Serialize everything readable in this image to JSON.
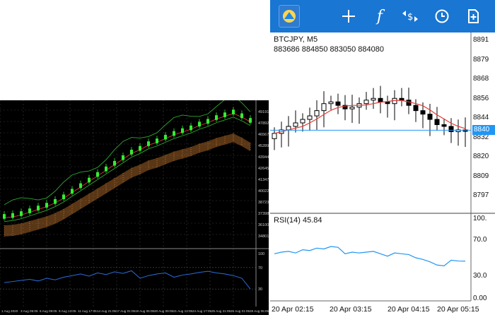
{
  "left_panel": {
    "price_ticks": [
      "491911",
      "478926",
      "465679",
      "452890",
      "439441",
      "426456",
      "413471",
      "400221",
      "387236",
      "373986",
      "361001",
      "348016"
    ],
    "rsi_ticks": [
      "100",
      "70",
      "30"
    ],
    "time_ticks": [
      "1 Aug 2020",
      "3 Aug 05:05",
      "6 Aug 09:05",
      "9 Aug 13:05",
      "11 Aug 17:05",
      "14 Aug 21:05",
      "17 Aug 01:05",
      "19 Aug 05:05",
      "20 Aug 09:05",
      "21 Aug 13:05",
      "24 Aug 17:05",
      "25 Aug 21:05",
      "26 Aug 01:05",
      "28 Aug 05:05"
    ],
    "colors": {
      "background": "#000000",
      "candles": "#33ee33",
      "cloud": "#ff9a3c",
      "rsi": "#2b6cd8"
    }
  },
  "app": {
    "toolbar": {
      "icons": [
        "mt-logo-icon",
        "crosshair-icon",
        "indicators-icon",
        "trade-icon",
        "timeframe-icon",
        "add-object-icon"
      ],
      "color": "#1976d2"
    },
    "chart": {
      "symbol": "BTCJPY, M5",
      "ohlc": "883686 884850 883050 884080",
      "current_price": "8840",
      "price_ticks": [
        "8891",
        "8879",
        "8868",
        "8856",
        "8844",
        "8832",
        "8820",
        "8809",
        "8797"
      ],
      "colors": {
        "candles": "#000000",
        "ma": "#e53935",
        "price_line": "#2196f3"
      }
    },
    "rsi": {
      "label": "RSI(14) 45.84",
      "ticks": [
        "100.",
        "70.0",
        "30.0",
        "0.00"
      ]
    },
    "time_axis": [
      "20 Apr 02:15",
      "20 Apr 03:15",
      "20 Apr 04:15",
      "20 Apr 05:15"
    ]
  },
  "chart_data": [
    {
      "type": "line",
      "series": [
        {
          "name": "price",
          "values": [
            377,
            378,
            380,
            383,
            386,
            389,
            393,
            398,
            404,
            410,
            416,
            422,
            428,
            434,
            440,
            446,
            450,
            455,
            458,
            462,
            466,
            469,
            472,
            476,
            479,
            483,
            486,
            489,
            485,
            480
          ]
        },
        {
          "name": "rsi",
          "values": [
            42,
            44,
            46,
            48,
            45,
            50,
            47,
            52,
            55,
            58,
            54,
            60,
            57,
            62,
            59,
            64,
            50,
            55,
            58,
            60,
            52,
            56,
            58,
            61,
            63,
            60,
            58,
            55,
            50,
            30
          ]
        }
      ]
    },
    {
      "type": "line",
      "series": [
        {
          "name": "close",
          "values": [
            883900,
            884100,
            884300,
            884500,
            884700,
            884900,
            885200,
            885600,
            885700,
            885500,
            885300,
            885400,
            885600,
            885800,
            885900,
            885700,
            885600,
            885900,
            885800,
            885500,
            885200,
            885000,
            884700,
            884400,
            884300,
            884000,
            884100,
            884080
          ]
        },
        {
          "name": "rsi",
          "values": [
            55,
            57,
            58,
            56,
            60,
            59,
            62,
            61,
            64,
            63,
            55,
            57,
            56,
            57,
            58,
            55,
            52,
            56,
            55,
            54,
            50,
            48,
            45,
            41,
            40,
            47,
            46,
            45.84
          ]
        }
      ]
    }
  ]
}
